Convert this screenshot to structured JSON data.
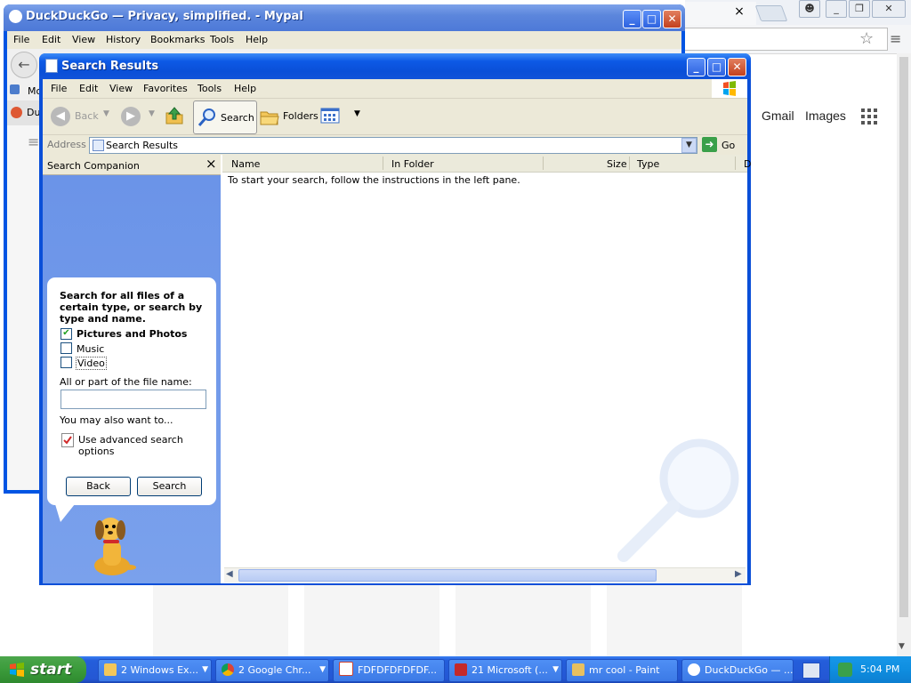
{
  "chrome": {
    "tab_close": "×",
    "window_controls": [
      "_",
      "❐",
      "✕"
    ],
    "links": {
      "gmail": "Gmail",
      "images": "Images"
    }
  },
  "mypal": {
    "title": "DuckDuckGo — Privacy, simplified. - Mypal",
    "menu": [
      "File",
      "Edit",
      "View",
      "History",
      "Bookmarks",
      "Tools",
      "Help"
    ],
    "bookmark_partial": "Mo",
    "tab_partial": "Du"
  },
  "search_window": {
    "title": "Search Results",
    "menu": [
      "File",
      "Edit",
      "View",
      "Favorites",
      "Tools",
      "Help"
    ],
    "toolbar": {
      "back": "Back",
      "search": "Search",
      "folders": "Folders"
    },
    "address": {
      "label": "Address",
      "value": "Search Results",
      "go": "Go"
    },
    "companion": {
      "header": "Search Companion",
      "prompt": "Search for all files of a certain type, or search by type and name.",
      "options": [
        {
          "label": "Pictures and Photos",
          "checked": true
        },
        {
          "label": "Music",
          "checked": false
        },
        {
          "label": "Video",
          "checked": false
        }
      ],
      "file_name_label": "All or part of the file name:",
      "file_name_value": "",
      "also_label": "You may also want to...",
      "advanced_label": "Use advanced search options",
      "back_button": "Back",
      "search_button": "Search"
    },
    "columns": [
      "Name",
      "In Folder",
      "Size",
      "Type",
      "D"
    ],
    "empty_message": "To start your search, follow the instructions in the left pane."
  },
  "taskbar": {
    "start": "start",
    "tasks": [
      {
        "label": "2 Windows Ex...",
        "icon": "folder-icon",
        "grouped": true
      },
      {
        "label": "2 Google Chr...",
        "icon": "chrome-icon",
        "grouped": true
      },
      {
        "label": "FDFDFDFDFDF...",
        "icon": "document-icon",
        "grouped": false
      },
      {
        "label": "21 Microsoft (...",
        "icon": "vb-icon",
        "grouped": true
      },
      {
        "label": "mr cool - Paint",
        "icon": "paint-icon",
        "grouped": false
      },
      {
        "label": "DuckDuckGo — ...",
        "icon": "mypal-icon",
        "grouped": false
      }
    ],
    "clock": "5:04 PM"
  },
  "colors": {
    "xp_blue": "#0a4fd8",
    "taskbar": "#245edb",
    "start_green": "#3b9b3b",
    "companion_blue": "#7aa1ec",
    "xp_face": "#ece9d8"
  }
}
